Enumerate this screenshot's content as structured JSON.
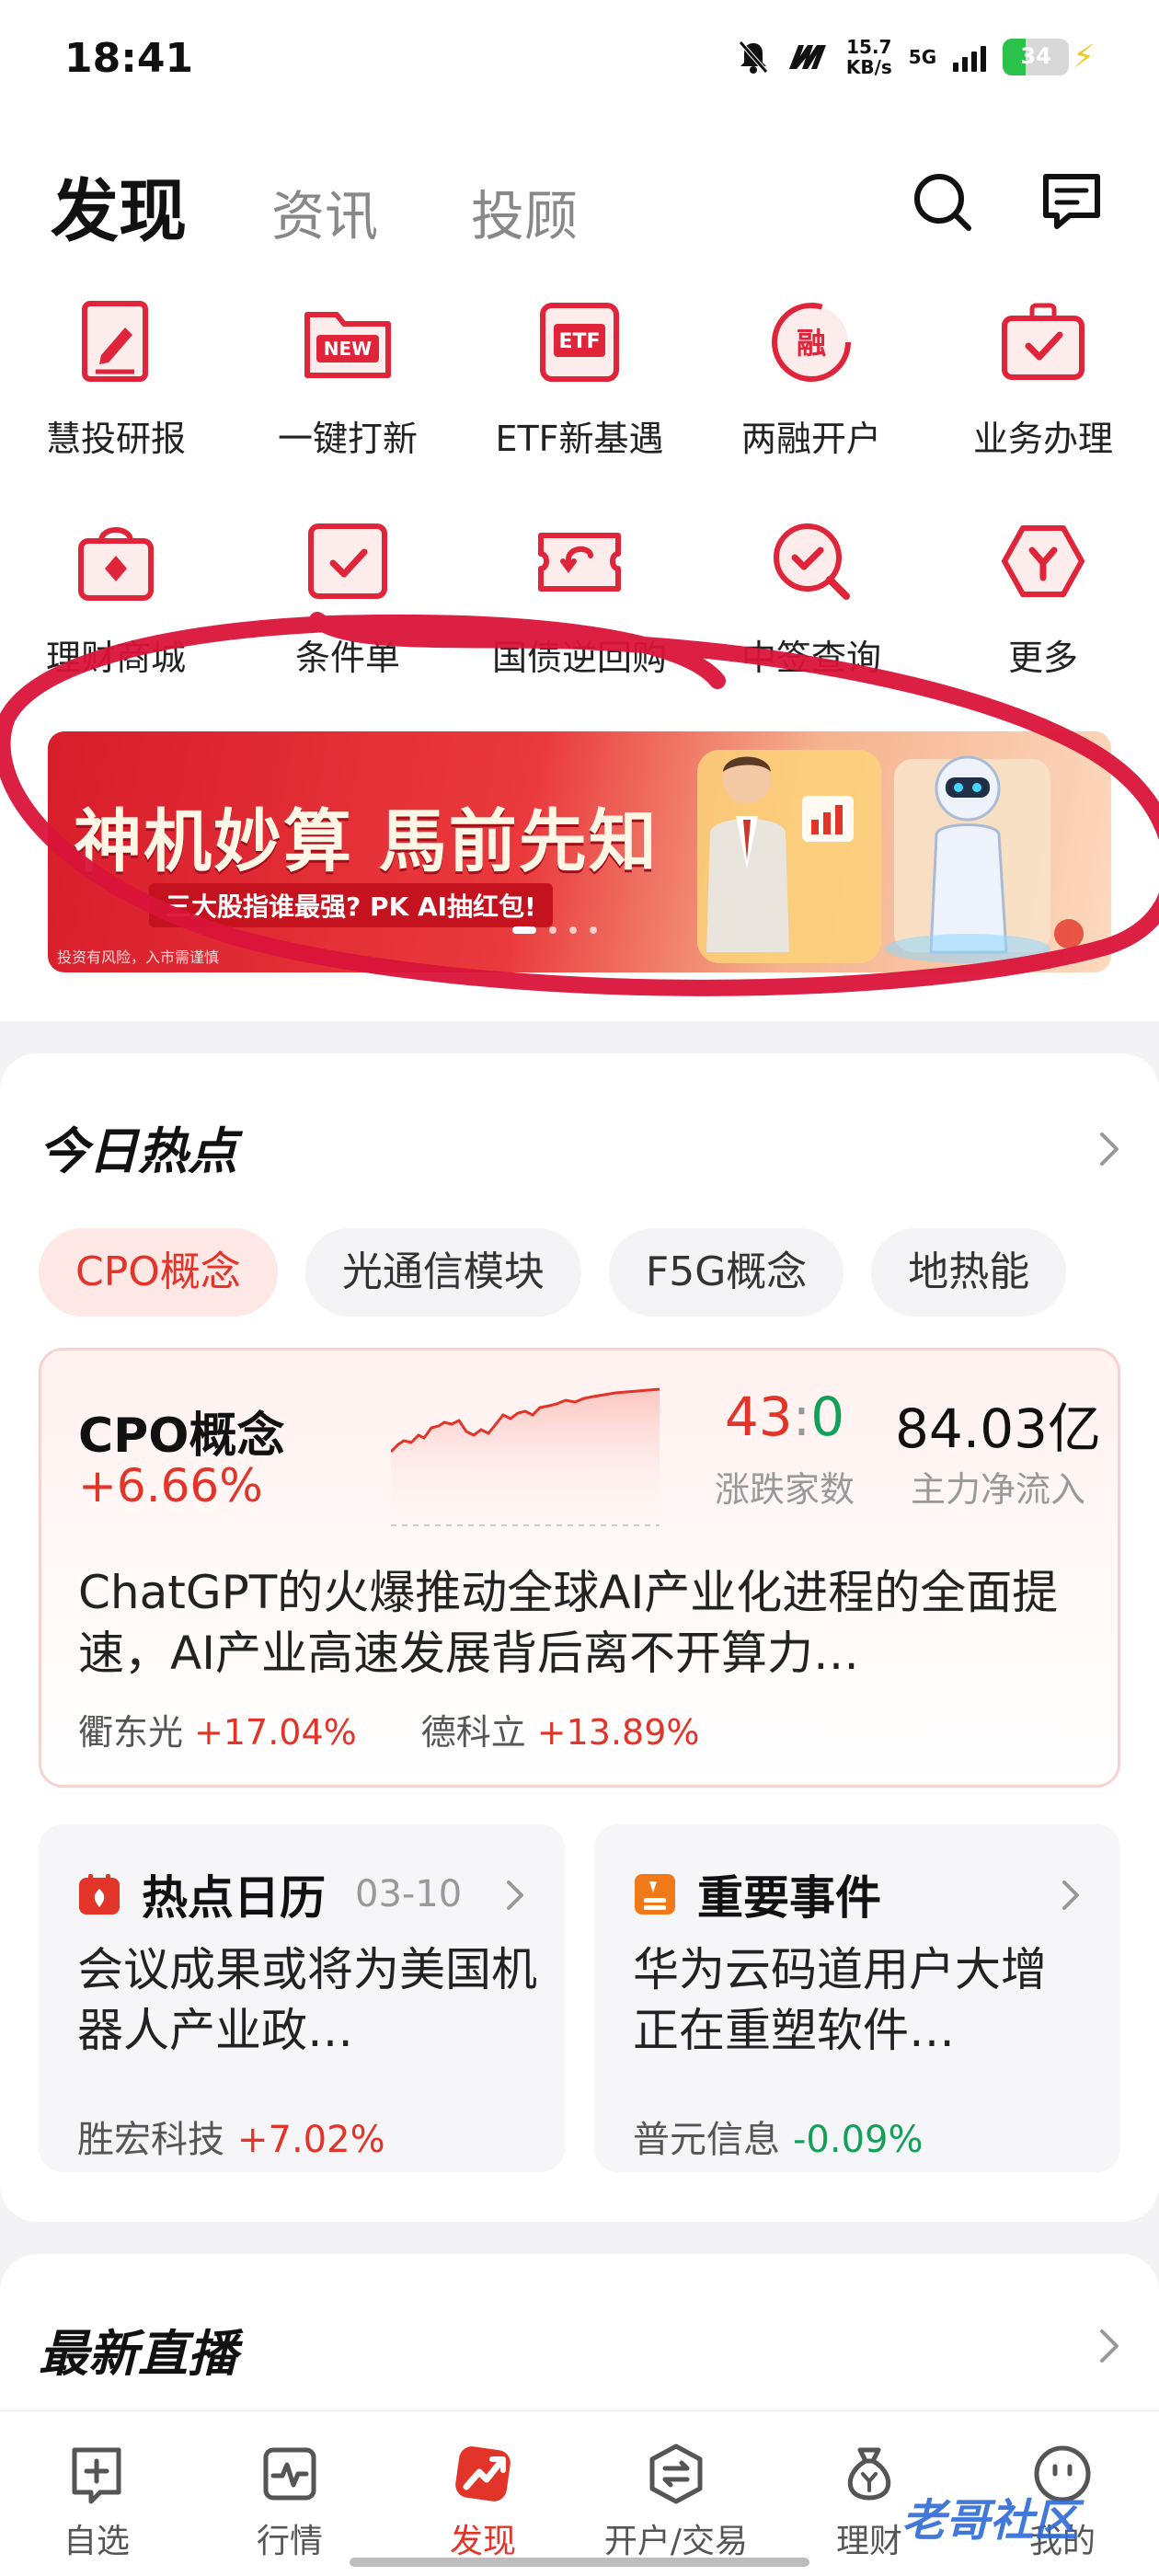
{
  "status_bar": {
    "time": "18:41",
    "net_speed_value": "15.7",
    "net_speed_unit": "KB/s",
    "network": "5G",
    "battery": "34",
    "battery_level": 0.34
  },
  "header": {
    "tabs": [
      {
        "label": "发现",
        "active": true
      },
      {
        "label": "资讯",
        "active": false
      },
      {
        "label": "投顾",
        "active": false
      }
    ]
  },
  "services": [
    {
      "label": "慧投研报",
      "icon": "report-pen-icon"
    },
    {
      "label": "一键打新",
      "icon": "new-folder-icon"
    },
    {
      "label": "ETF新基遇",
      "icon": "etf-doc-icon"
    },
    {
      "label": "两融开户",
      "icon": "margin-account-icon"
    },
    {
      "label": "业务办理",
      "icon": "briefcase-check-icon"
    },
    {
      "label": "理财商城",
      "icon": "shopping-bag-icon"
    },
    {
      "label": "条件单",
      "icon": "condition-order-icon"
    },
    {
      "label": "国债逆回购",
      "icon": "bond-repo-icon"
    },
    {
      "label": "中签查询",
      "icon": "lottery-search-icon"
    },
    {
      "label": "更多",
      "icon": "more-hexagon-icon"
    }
  ],
  "banner": {
    "title": "神机妙算 馬前先知",
    "subtitle": "三大股指谁最强? PK AI抽红包!",
    "note": "投资有风险，入市需谨慎",
    "slide_count": 4,
    "active_slide": 1
  },
  "hot": {
    "title": "今日热点",
    "chips": [
      {
        "label": "CPO概念",
        "active": true
      },
      {
        "label": "光通信模块",
        "active": false
      },
      {
        "label": "F5G概念",
        "active": false
      },
      {
        "label": "地热能",
        "active": false
      }
    ],
    "concept": {
      "name": "CPO概念",
      "change": "+6.66%",
      "up_count": "43",
      "separator": ":",
      "down_count": "0",
      "ratio_label": "涨跌家数",
      "net_inflow": "84.03亿",
      "inflow_label": "主力净流入",
      "description": "ChatGPT的火爆推动全球AI产业化进程的全面提速，AI产业高速发展背后离不开算力…",
      "stocks": [
        {
          "name": "衢东光",
          "change": "+17.04%"
        },
        {
          "name": "德科立",
          "change": "+13.89%"
        }
      ]
    },
    "calendar": {
      "title": "热点日历",
      "date": "03-10",
      "text": "会议成果或将为美国机器人产业政…",
      "stock": "胜宏科技",
      "change": "+7.02%"
    },
    "events": {
      "title": "重要事件",
      "text": "华为云码道用户大增  正在重塑软件…",
      "stock": "普元信息",
      "change": "-0.09%"
    }
  },
  "live": {
    "title": "最新直播"
  },
  "bottom_nav": [
    {
      "label": "自选",
      "icon": "watchlist-icon",
      "active": false
    },
    {
      "label": "行情",
      "icon": "market-chart-icon",
      "active": false
    },
    {
      "label": "发现",
      "icon": "discover-icon",
      "active": true
    },
    {
      "label": "开户/交易",
      "icon": "trade-swap-icon",
      "active": false
    },
    {
      "label": "理财",
      "icon": "money-bag-icon",
      "active": false
    },
    {
      "label": "我的",
      "icon": "profile-icon",
      "active": false
    }
  ],
  "watermark": "老哥社区",
  "colors": {
    "accent_red": "#e23428",
    "down_green": "#14a05a",
    "annotation_red": "#d9143a"
  }
}
